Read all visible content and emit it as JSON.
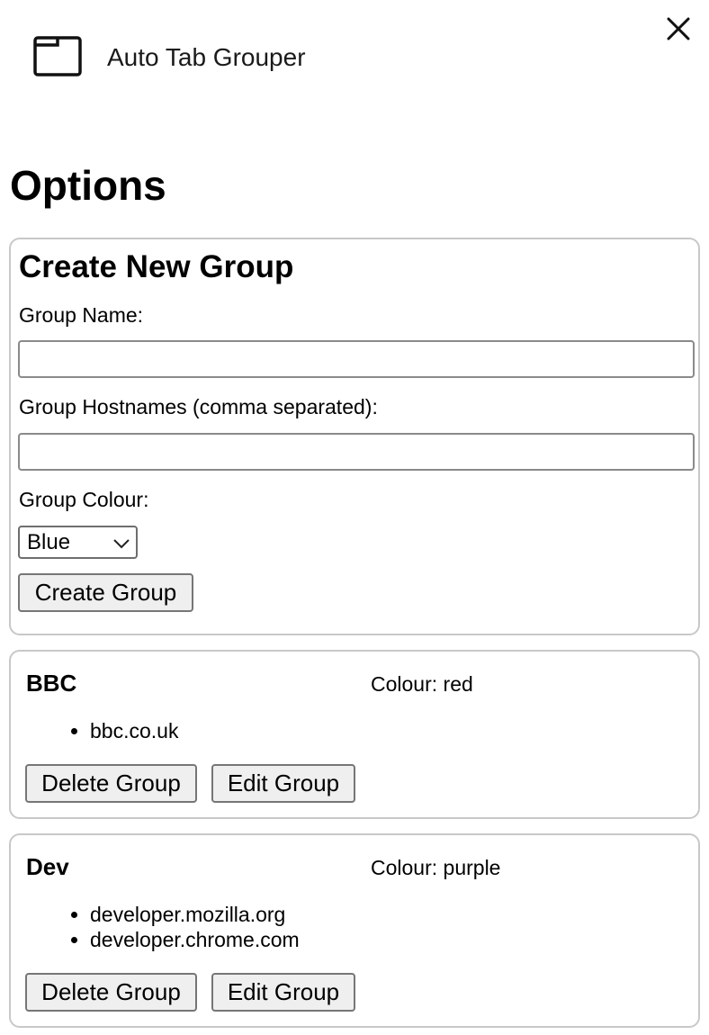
{
  "window": {
    "title": "Auto Tab Grouper",
    "icon": "browser-window-icon",
    "close_icon": "close-icon"
  },
  "page": {
    "title": "Options"
  },
  "create_group": {
    "heading": "Create New Group",
    "name_label": "Group Name:",
    "name_value": "",
    "hostnames_label": "Group Hostnames (comma separated):",
    "hostnames_value": "",
    "colour_label": "Group Colour:",
    "colour_selected": "Blue",
    "submit_label": "Create Group"
  },
  "groups": [
    {
      "name": "BBC",
      "colour_text": "Colour: red",
      "hostnames": [
        "bbc.co.uk"
      ],
      "delete_label": "Delete Group",
      "edit_label": "Edit Group"
    },
    {
      "name": "Dev",
      "colour_text": "Colour: purple",
      "hostnames": [
        "developer.mozilla.org",
        "developer.chrome.com"
      ],
      "delete_label": "Delete Group",
      "edit_label": "Edit Group"
    }
  ]
}
